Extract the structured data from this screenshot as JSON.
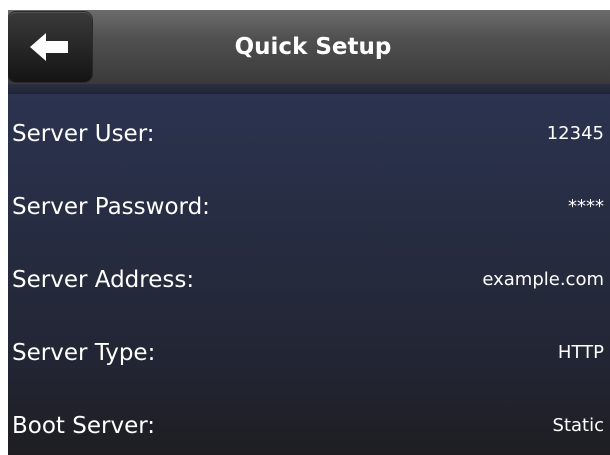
{
  "header": {
    "title": "Quick Setup",
    "back_icon": "arrow-left-icon"
  },
  "rows": [
    {
      "label": "Server User:",
      "value": "12345"
    },
    {
      "label": "Server Password:",
      "value": "****"
    },
    {
      "label": "Server Address:",
      "value": "example.com"
    },
    {
      "label": "Server Type:",
      "value": "HTTP"
    },
    {
      "label": "Boot Server:",
      "value": "Static"
    }
  ],
  "colors": {
    "header": "#4f4f4f",
    "list_background": "#262c40",
    "text": "#ffffff"
  }
}
